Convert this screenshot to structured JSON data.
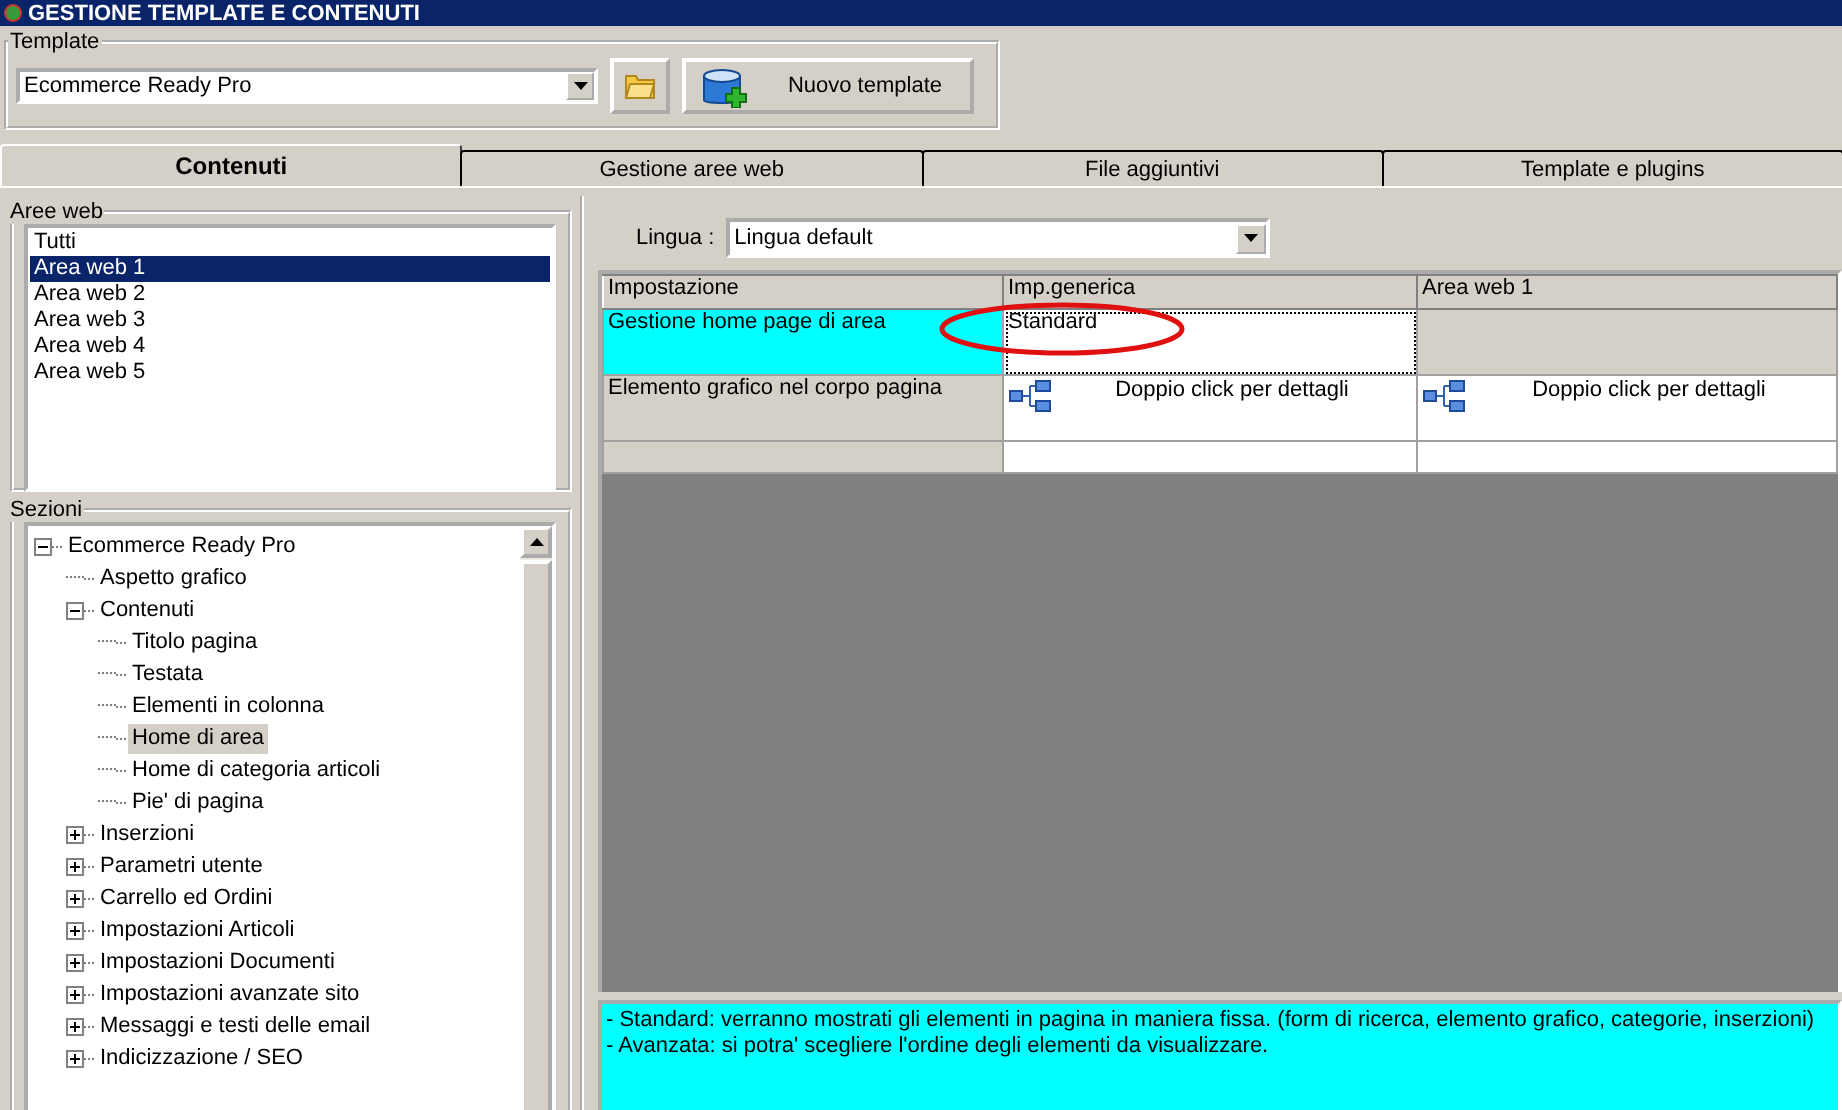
{
  "window": {
    "title": "GESTIONE TEMPLATE E CONTENUTI"
  },
  "template": {
    "label": "Template",
    "value": "Ecommerce Ready Pro",
    "new_button": "Nuovo template"
  },
  "tabs": [
    {
      "label": "Contenuti",
      "selected": true
    },
    {
      "label": "Gestione aree web",
      "selected": false
    },
    {
      "label": "File aggiuntivi",
      "selected": false
    },
    {
      "label": "Template e plugins",
      "selected": false
    }
  ],
  "web_areas": {
    "label": "Aree web",
    "items": [
      {
        "label": "Tutti",
        "selected": false
      },
      {
        "label": "Area web 1",
        "selected": true
      },
      {
        "label": "Area web 2",
        "selected": false
      },
      {
        "label": "Area web 3",
        "selected": false
      },
      {
        "label": "Area web 4",
        "selected": false
      },
      {
        "label": "Area web 5",
        "selected": false
      }
    ]
  },
  "sections": {
    "label": "Sezioni",
    "items": [
      {
        "label": "Ecommerce Ready Pro",
        "kind": "group",
        "expanded": true,
        "selected": false,
        "children": [
          {
            "label": "Aspetto grafico",
            "kind": "leaf",
            "selected": false
          },
          {
            "label": "Contenuti",
            "kind": "group",
            "expanded": true,
            "selected": false,
            "children": [
              {
                "label": "Titolo pagina",
                "kind": "leaf",
                "selected": false
              },
              {
                "label": "Testata",
                "kind": "leaf",
                "selected": false
              },
              {
                "label": "Elementi in colonna",
                "kind": "leaf",
                "selected": false
              },
              {
                "label": "Home di area",
                "kind": "leaf",
                "selected": true
              },
              {
                "label": "Home di categoria articoli",
                "kind": "leaf",
                "selected": false
              },
              {
                "label": "Pie' di pagina",
                "kind": "leaf",
                "selected": false
              }
            ]
          },
          {
            "label": "Inserzioni",
            "kind": "group",
            "expanded": false,
            "selected": false
          },
          {
            "label": "Parametri utente",
            "kind": "group",
            "expanded": false,
            "selected": false
          },
          {
            "label": "Carrello ed Ordini",
            "kind": "group",
            "expanded": false,
            "selected": false
          },
          {
            "label": "Impostazioni Articoli",
            "kind": "group",
            "expanded": false,
            "selected": false
          },
          {
            "label": "Impostazioni Documenti",
            "kind": "group",
            "expanded": false,
            "selected": false
          },
          {
            "label": "Impostazioni avanzate sito",
            "kind": "group",
            "expanded": false,
            "selected": false
          },
          {
            "label": "Messaggi e testi delle email",
            "kind": "group",
            "expanded": false,
            "selected": false
          },
          {
            "label": "Indicizzazione / SEO",
            "kind": "group",
            "expanded": false,
            "selected": false
          }
        ]
      }
    ]
  },
  "language": {
    "label": "Lingua :",
    "value": "Lingua default"
  },
  "grid": {
    "columns": [
      "Impostazione",
      "Imp.generica",
      "Area web 1"
    ],
    "rows": [
      {
        "kind": "setting",
        "selected": true,
        "cells": [
          {
            "kind": "setting",
            "text": "Gestione home page di area",
            "focused": false
          },
          {
            "kind": "text",
            "text": "Standard",
            "focused": true
          },
          {
            "kind": "disabled",
            "focused": false
          }
        ]
      },
      {
        "kind": "setting",
        "selected": false,
        "cells": [
          {
            "kind": "setting",
            "text": "Elemento grafico nel corpo pagina",
            "focused": false
          },
          {
            "kind": "detail",
            "text": "Doppio click per dettagli",
            "focused": false
          },
          {
            "kind": "detail",
            "text": "Doppio click per dettagli",
            "focused": false
          }
        ]
      },
      {
        "kind": "new",
        "selected": false,
        "cells": [
          {
            "kind": "setting",
            "focused": false
          },
          {
            "kind": "empty",
            "focused": false
          },
          {
            "kind": "empty",
            "focused": false
          }
        ]
      }
    ]
  },
  "description": [
    "- Standard: verranno mostrati gli elementi in pagina in maniera fissa. (form di ricerca, elemento grafico, categorie, inserzioni)",
    "- Avanzata: si potra' scegliere l'ordine degli elementi da visualizzare."
  ]
}
